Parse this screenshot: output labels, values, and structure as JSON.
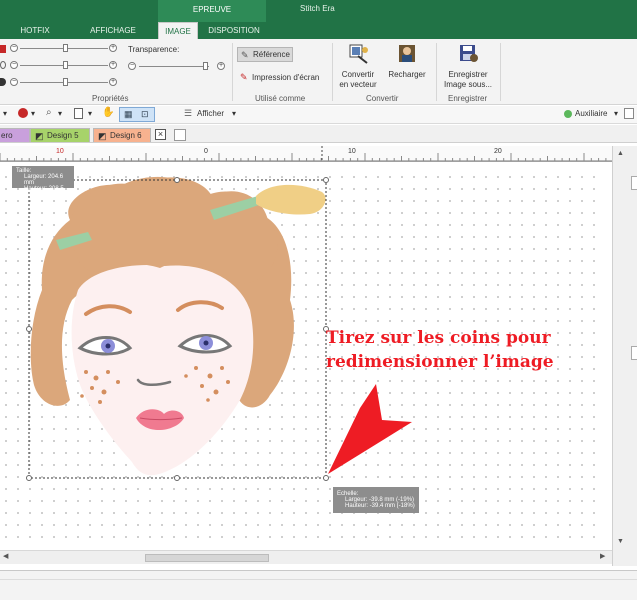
{
  "window": {
    "context_group": "EPREUVE",
    "app_title": "Stitch Era"
  },
  "ribbon_tabs": [
    {
      "label": "HOTFIX",
      "active": false
    },
    {
      "label": "AFFICHAGE",
      "active": false
    },
    {
      "label": "IMAGE",
      "active": true
    },
    {
      "label": "DISPOSITION",
      "active": false
    }
  ],
  "ribbon": {
    "transparence_label": "Transparence:",
    "proprietes_label": "Propriétés",
    "reference_label": "Référence",
    "impression_label": "Impression d'écran",
    "utilise_comme_label": "Utilisé comme",
    "convertir_vecteur_label_1": "Convertir",
    "convertir_vecteur_label_2": "en vecteur",
    "recharger_label": "Recharger",
    "convertir_group_label": "Convertir",
    "enregistrer_label_1": "Enregistrer",
    "enregistrer_label_2": "Image sous...",
    "enregistrer_group_label": "Enregistrer"
  },
  "toolbar": {
    "afficher_label": "Afficher",
    "auxiliaire_label": "Auxiliaire"
  },
  "doc_tabs": [
    {
      "label": "ero",
      "color": "#c9a0dc"
    },
    {
      "label": "Design 5",
      "color": "#a7d36a"
    },
    {
      "label": "Design 6",
      "color": "#f7b28f"
    }
  ],
  "ruler": {
    "labels": [
      "10",
      "0",
      "10",
      "20"
    ]
  },
  "image_info": {
    "line1": "Taille:",
    "line2": "Largeur: 204.6 mm",
    "line3": "Hauteur: 208.5 mm"
  },
  "scale_info": {
    "line1": "Echelle:",
    "line2": "Largeur: -39.8 mm (-19%)",
    "line3": "Hauteur: -39.4 mm (-18%)"
  },
  "annotation": {
    "line1": "Tirez sur les coins pour",
    "line2": "redimensionner l’image",
    "color": "#ee1c24"
  },
  "colors": {
    "accent": "#217346",
    "hair": "#dba77b",
    "skin": "#fdf0f0",
    "eye": "#8c8ed9"
  }
}
